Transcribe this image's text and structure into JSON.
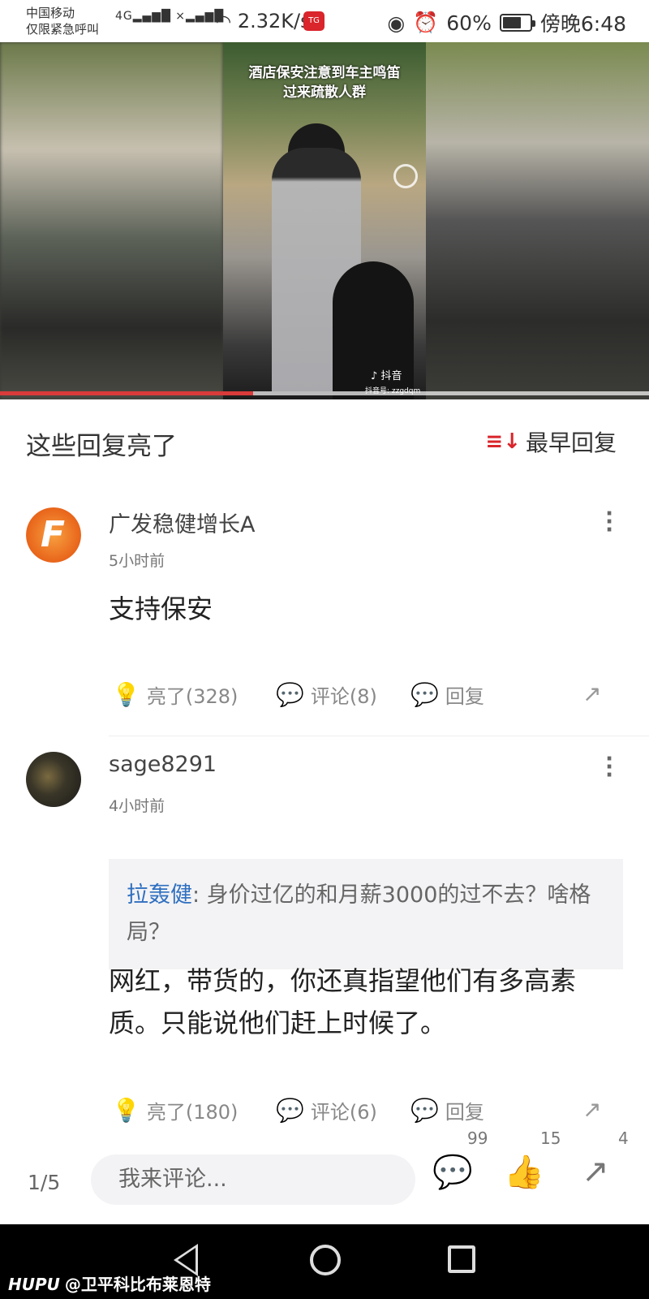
{
  "status_bar": {
    "carrier": "中国移动",
    "carrier_sub": "仅限紧急呼叫",
    "network": "4G",
    "speed": "2.32K/s",
    "app_badge": "TG",
    "battery": "60%",
    "time": "傍晚6:48"
  },
  "video": {
    "caption_line1": "酒店保安注意到车主鸣笛",
    "caption_line2": "过来疏散人群",
    "platform": "抖音",
    "account": "抖音号: zzgdqm",
    "progress": 0.39
  },
  "section": {
    "title": "这些回复亮了",
    "sort_label": "最早回复",
    "sort_icon": "sort-desc-icon"
  },
  "comments": [
    {
      "username": "广发稳健增长A",
      "time": "5小时前",
      "text": "支持保安",
      "likes": "亮了(328)",
      "replies_count": "评论(8)",
      "reply": "回复"
    },
    {
      "username": "sage8291",
      "time": "4小时前",
      "quote_user": "拉轰健",
      "quote_text": ": 身价过亿的和月薪3000的过不去？啥格局？",
      "text": "网红，带货的，你还真指望他们有多高素质。只能说他们赶上时候了。",
      "likes": "亮了(180)",
      "replies_count": "评论(6)",
      "reply": "回复"
    }
  ],
  "bottom_bar": {
    "page": "1/5",
    "placeholder": "我来评论...",
    "comment_count": "99",
    "like_count": "15",
    "share_count": "4"
  },
  "watermark": {
    "brand": "HUPU",
    "user": "@卫平科比布莱恩特"
  }
}
